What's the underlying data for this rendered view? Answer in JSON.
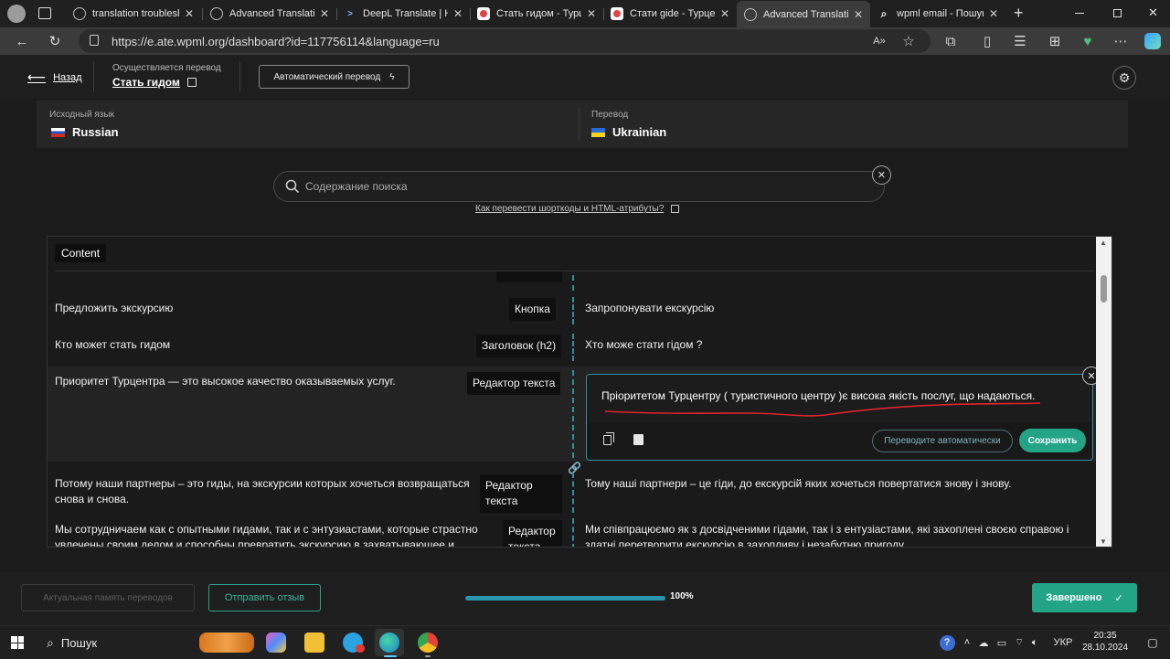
{
  "browser": {
    "tabs": [
      {
        "title": "translation troublesho",
        "icon": "github-icon"
      },
      {
        "title": "Advanced Translation",
        "icon": "github-icon"
      },
      {
        "title": "DeepL Translate | Най",
        "icon": "deepl-icon"
      },
      {
        "title": "Стать гидом - Турцен",
        "icon": "site-icon"
      },
      {
        "title": "Стати gide - Турцент",
        "icon": "site-icon"
      },
      {
        "title": "Advanced Translation",
        "icon": "github-icon"
      },
      {
        "title": "wpml email - Пошук",
        "icon": "search-icon"
      }
    ],
    "url": "https://e.ate.wpml.org/dashboard?id=117756114&language=ru"
  },
  "header": {
    "back_label": "Назад",
    "progress_label": "Осуществляется перевод",
    "page_link": "Стать гидом",
    "auto_translate_label": "Автоматический перевод"
  },
  "languages": {
    "source_label": "Исходный язык",
    "source": "Russian",
    "target_label": "Перевод",
    "target": "Ukrainian"
  },
  "search": {
    "placeholder": "Содержание поиска",
    "help_link": "Как перевести шорткоды и HTML-атрибуты?"
  },
  "content": {
    "section_label": "Content",
    "rows": [
      {
        "source": "Предложить экскурсию",
        "type": "Кнопка",
        "target": "Запропонувати екскурсію"
      },
      {
        "source": "Кто может стать гидом",
        "type": "Заголовок (h2)",
        "target": "Хто може стати гідом ?"
      },
      {
        "source": "Приоритет Турцентра — это высокое качество оказываемых услуг.",
        "type": "Редактор текста",
        "target": "Пріоритетом Турцентру ( туристичного центру )є висока якість послуг, що надаються."
      },
      {
        "source_line1": "Потому наши партнеры – это гиды, на экскурсии которых хочеться возвращаться",
        "source_line2": "снова и снова.",
        "type_line1": "Редактор",
        "type_line2": "текста",
        "target": "Тому наші партнери – це гіди, до екскурсій яких хочеться повертатися знову і знову."
      },
      {
        "source_line1": "Мы сотрудничаем как с опытными гидами, так и с энтузиастами, которые страстно",
        "source_line2": "увлечены своим делом и способны превратить экскурсию в захватывающее и",
        "type_line1": "Редактор",
        "type_line2": "текста",
        "target_line1": "Ми співпрацюємо як з досвідченими гідами, так і з ентузіастами, які захоплені своєю справою і",
        "target_line2": "здатні перетворити екскурсію в захопливу і незабутню пригоду."
      }
    ],
    "editor": {
      "auto_translate": "Переводите автоматически",
      "save": "Сохранить"
    }
  },
  "footer": {
    "tm_label": "Актуальная память переводов",
    "feedback_label": "Отправить отзыв",
    "progress_value": 100,
    "progress_text": "100%",
    "done_label": "Завершено"
  },
  "taskbar": {
    "search_label": "Пошук",
    "lang": "УКР",
    "time": "20:35",
    "date": "28.10.2024"
  },
  "colors": {
    "accent": "#23a487",
    "divider": "#2c8fa6",
    "squiggle": "#e0242c"
  }
}
